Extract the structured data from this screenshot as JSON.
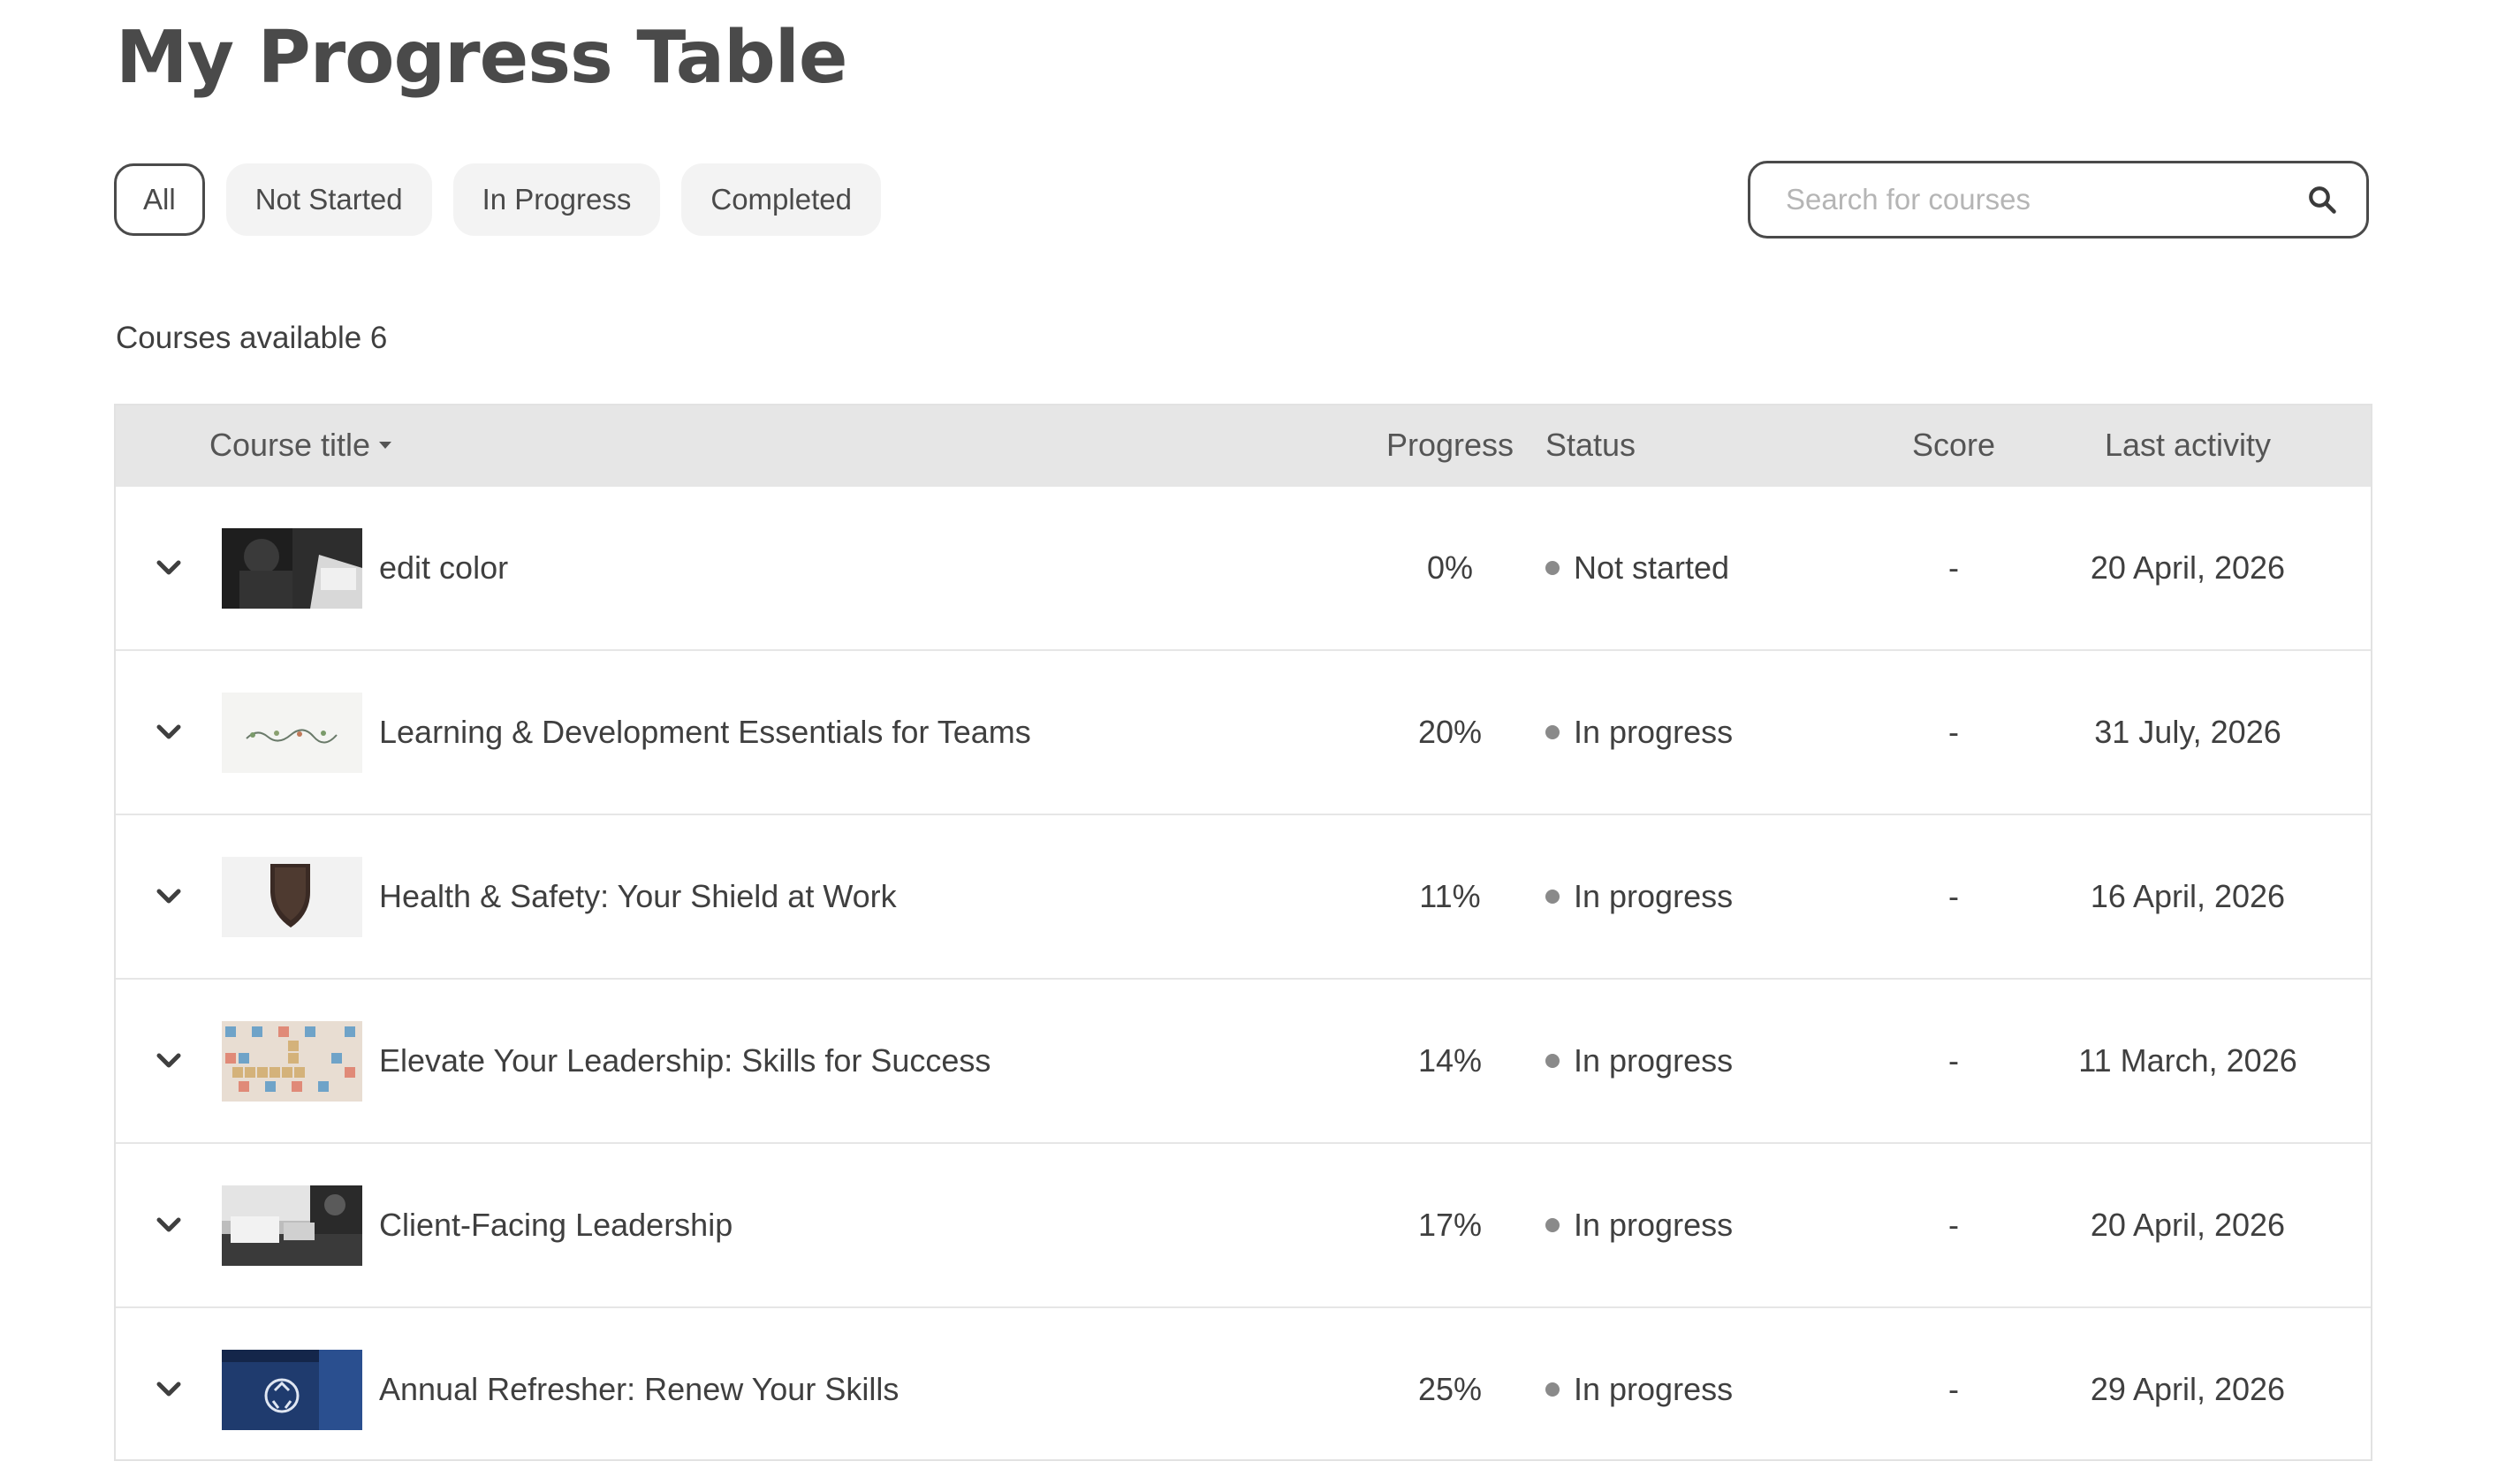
{
  "page": {
    "title": "My Progress Table"
  },
  "filters": [
    {
      "label": "All",
      "active": true
    },
    {
      "label": "Not Started",
      "active": false
    },
    {
      "label": "In Progress",
      "active": false
    },
    {
      "label": "Completed",
      "active": false
    }
  ],
  "search": {
    "placeholder": "Search for courses",
    "value": ""
  },
  "courses_count": "Courses available 6",
  "table": {
    "headers": {
      "title": "Course title",
      "progress": "Progress",
      "status": "Status",
      "score": "Score",
      "last_activity": "Last activity"
    },
    "sort_icon": "caret-down-icon",
    "rows": [
      {
        "title": "edit color",
        "progress": "0%",
        "status": "Not started",
        "score": "-",
        "last_activity": "20 April, 2026",
        "thumbnail": "person-at-laptop-image"
      },
      {
        "title": "Learning & Development Essentials for Teams",
        "progress": "20%",
        "status": "In progress",
        "score": "-",
        "last_activity": "31 July, 2026",
        "thumbnail": "plant-growth-image"
      },
      {
        "title": "Health & Safety: Your Shield at Work",
        "progress": "11%",
        "status": "In progress",
        "score": "-",
        "last_activity": "16 April, 2026",
        "thumbnail": "shield-image"
      },
      {
        "title": "Elevate Your Leadership: Skills for Success",
        "progress": "14%",
        "status": "In progress",
        "score": "-",
        "last_activity": "11 March, 2026",
        "thumbnail": "scrabble-tiles-image"
      },
      {
        "title": "Client-Facing Leadership",
        "progress": "17%",
        "status": "In progress",
        "score": "-",
        "last_activity": "20 April, 2026",
        "thumbnail": "office-desk-image"
      },
      {
        "title": "Annual Refresher: Renew Your Skills",
        "progress": "25%",
        "status": "In progress",
        "score": "-",
        "last_activity": "29 April, 2026",
        "thumbnail": "recycle-bin-image"
      }
    ]
  },
  "colors": {
    "chip_bg": "#f3f3f3",
    "header_bg": "#e6e6e6",
    "status_dot": "#8a8a8a",
    "text": "#3f3f3f"
  }
}
